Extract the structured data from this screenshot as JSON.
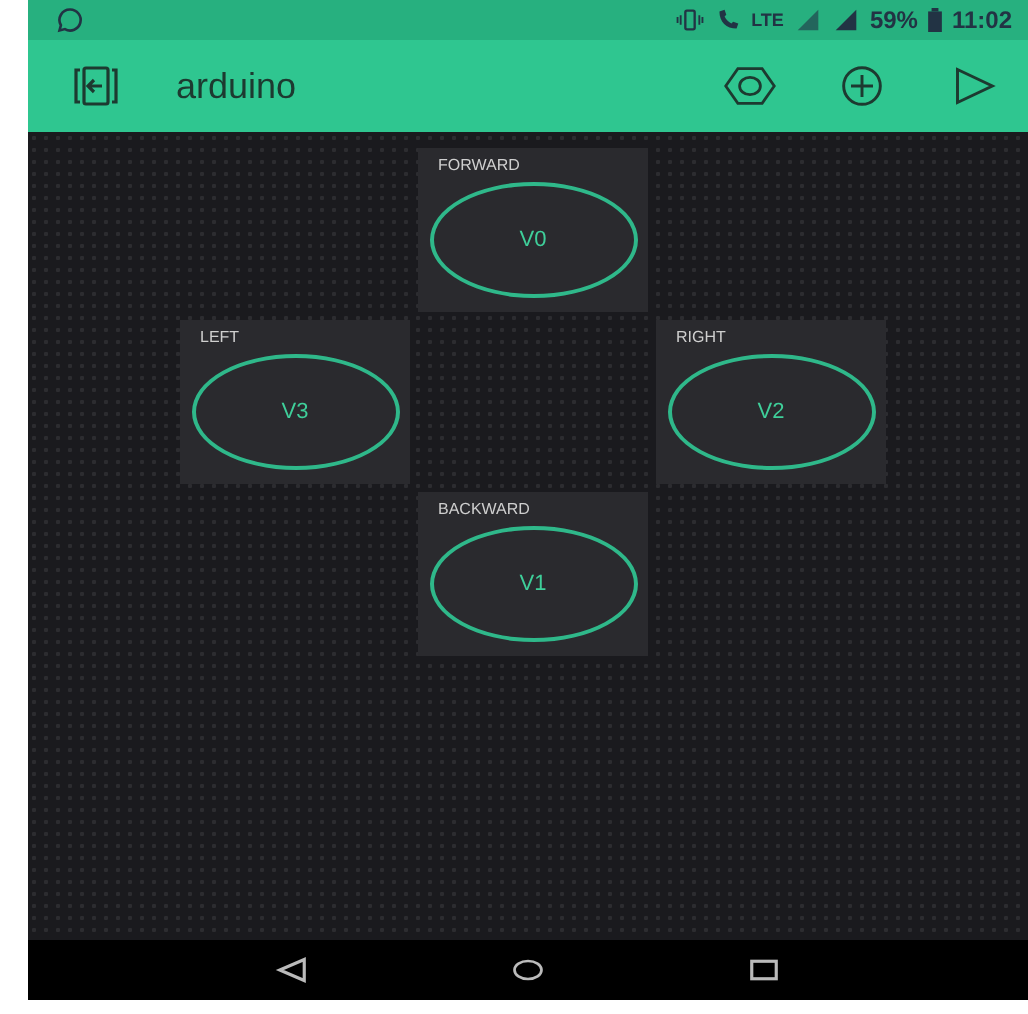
{
  "status_bar": {
    "network": "LTE",
    "battery": "59%",
    "time": "11:02"
  },
  "app_bar": {
    "title": "arduino"
  },
  "widget_rows": [
    [
      {
        "kind": "empty"
      },
      {
        "kind": "button",
        "label": "FORWARD",
        "pin": "V0"
      },
      {
        "kind": "empty"
      }
    ],
    [
      {
        "kind": "button",
        "label": "LEFT",
        "pin": "V3"
      },
      {
        "kind": "empty"
      },
      {
        "kind": "button",
        "label": "RIGHT",
        "pin": "V2"
      }
    ],
    [
      {
        "kind": "empty"
      },
      {
        "kind": "button",
        "label": "BACKWARD",
        "pin": "V1"
      },
      {
        "kind": "empty"
      }
    ]
  ]
}
